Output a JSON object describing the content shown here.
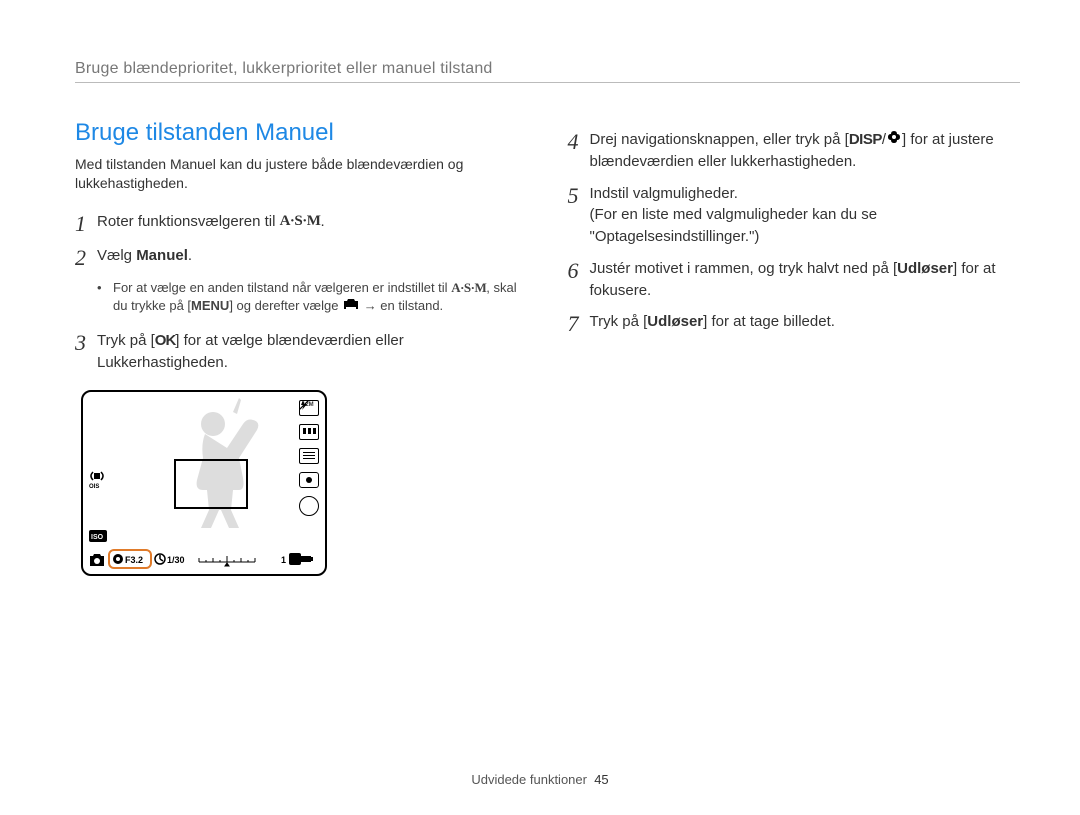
{
  "runningHead": "Bruge blændeprioritet, lukkerprioritet eller manuel tilstand",
  "section": {
    "title": "Bruge tilstanden Manuel",
    "intro": "Med tilstanden Manuel kan du justere både blændeværdien og lukkehastigheden."
  },
  "steps": {
    "s1": {
      "num": "1",
      "pre": "Roter funktionsvælgeren til ",
      "modeLabel": "A·S·M",
      "post": "."
    },
    "s2": {
      "num": "2",
      "pre": "Vælg ",
      "bold": "Manuel",
      "post": "."
    },
    "s2bullet": {
      "pre": "For at vælge en anden tilstand når vælgeren er indstillet til ",
      "mode": "A·S·M",
      "mid1": ", skal du trykke på [",
      "menu": "MENU",
      "mid2": "] og derefter vælge ",
      "arrow": " → en tilstand."
    },
    "s3": {
      "num": "3",
      "pre": "Tryk på [",
      "ok": "OK",
      "post": "] for at vælge blændeværdien eller Lukkerhastigheden."
    },
    "s4": {
      "num": "4",
      "pre": "Drej navigationsknappen, eller tryk på [",
      "disp": "DISP",
      "slash": "/",
      "post": "] for at justere blændeværdien eller lukkerhastigheden."
    },
    "s5": {
      "num": "5",
      "line1": "Indstil valgmuligheder.",
      "line2": "(For en liste med valgmuligheder kan du se \"Optagelsesindstillinger.\")"
    },
    "s6": {
      "num": "6",
      "pre": "Justér motivet i rammen, og tryk halvt ned på [",
      "bold": "Udløser",
      "post": "] for at fokusere."
    },
    "s7": {
      "num": "7",
      "pre": "Tryk på [",
      "bold": "Udløser",
      "post": "] for at tage billedet."
    }
  },
  "preview": {
    "fstop": "F3.2",
    "shutter": "1/30",
    "bars": "1"
  },
  "footer": {
    "section": "Udvidede funktioner",
    "page": "45"
  }
}
